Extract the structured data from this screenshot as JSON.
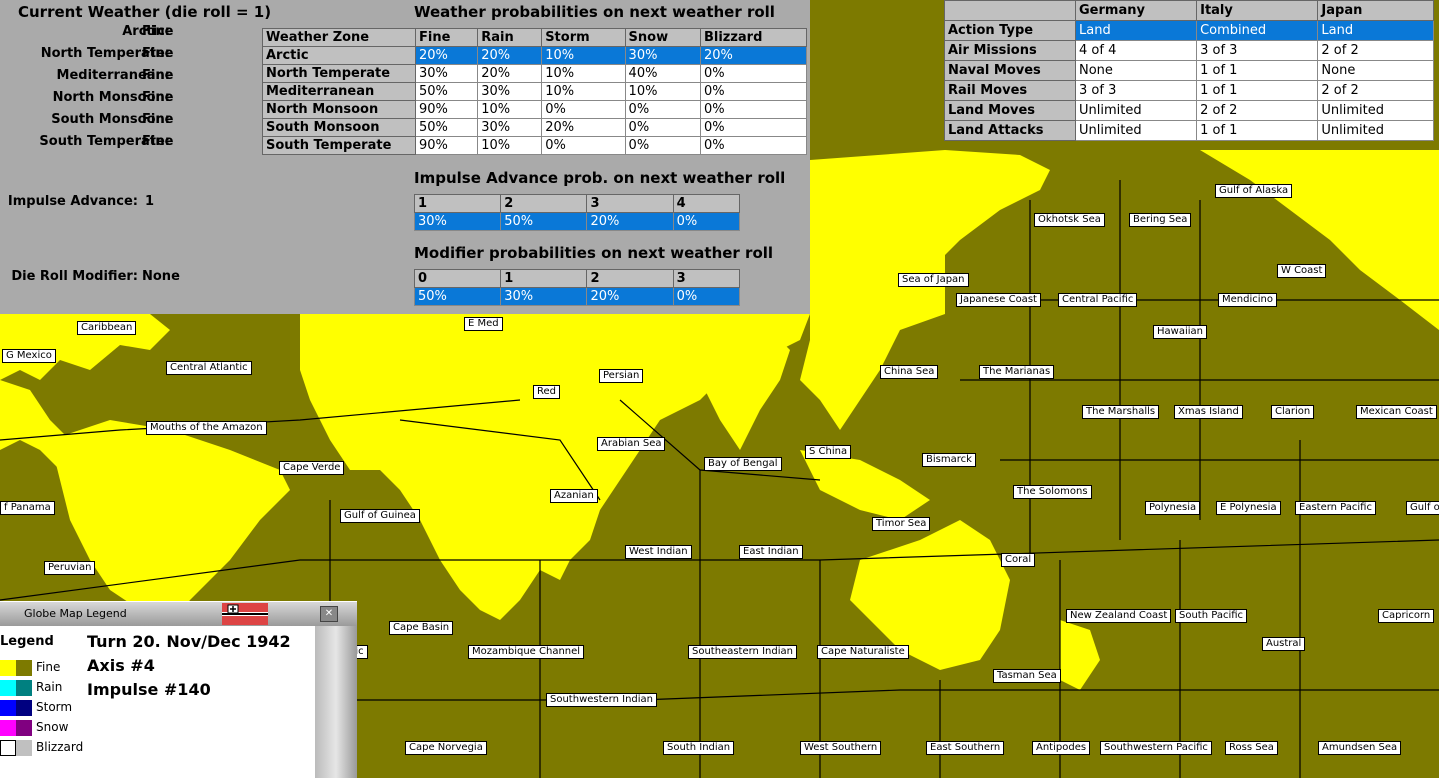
{
  "weather": {
    "title": "Current Weather (die roll = 1)",
    "zones": [
      {
        "label": "Arctic:",
        "value": "Fine"
      },
      {
        "label": "North Temperate:",
        "value": "Fine"
      },
      {
        "label": "Mediterranean:",
        "value": "Fine"
      },
      {
        "label": "North Monsoon:",
        "value": "Fine"
      },
      {
        "label": "South Monsoon:",
        "value": "Fine"
      },
      {
        "label": "South Temperate:",
        "value": "Fine"
      }
    ],
    "impulse_advance_label": "Impulse Advance:",
    "impulse_advance_value": "1",
    "die_roll_modifier_label": "Die Roll Modifier:",
    "die_roll_modifier_value": "None"
  },
  "probabilities": {
    "title": "Weather probabilities on next weather roll",
    "headers": [
      "Weather Zone",
      "Fine",
      "Rain",
      "Storm",
      "Snow",
      "Blizzard"
    ],
    "rows": [
      [
        "Arctic",
        "20%",
        "20%",
        "10%",
        "30%",
        "20%"
      ],
      [
        "North Temperate",
        "30%",
        "20%",
        "10%",
        "40%",
        "0%"
      ],
      [
        "Mediterranean",
        "50%",
        "30%",
        "10%",
        "10%",
        "0%"
      ],
      [
        "North Monsoon",
        "90%",
        "10%",
        "0%",
        "0%",
        "0%"
      ],
      [
        "South Monsoon",
        "50%",
        "30%",
        "20%",
        "0%",
        "0%"
      ],
      [
        "South Temperate",
        "90%",
        "10%",
        "0%",
        "0%",
        "0%"
      ]
    ]
  },
  "impulse_prob": {
    "title": "Impulse Advance prob. on next weather roll",
    "headers": [
      "1",
      "2",
      "3",
      "4"
    ],
    "values": [
      "30%",
      "50%",
      "20%",
      "0%"
    ]
  },
  "modifier_prob": {
    "title": "Modifier probabilities on next weather roll",
    "headers": [
      "0",
      "1",
      "2",
      "3"
    ],
    "values": [
      "50%",
      "30%",
      "20%",
      "0%"
    ]
  },
  "actions": {
    "headers": [
      "",
      "Germany",
      "Italy",
      "Japan"
    ],
    "rows": [
      [
        "Action Type",
        "Land",
        "Combined",
        "Land"
      ],
      [
        "Air Missions",
        "4 of 4",
        "3 of 3",
        "2 of 2"
      ],
      [
        "Naval Moves",
        "None",
        "1 of 1",
        "None"
      ],
      [
        "Rail Moves",
        "3 of 3",
        "1 of 1",
        "2 of 2"
      ],
      [
        "Land Moves",
        "Unlimited",
        "2 of 2",
        "Unlimited"
      ],
      [
        "Land Attacks",
        "Unlimited",
        "1 of 1",
        "Unlimited"
      ]
    ]
  },
  "legend": {
    "window_title": "Globe Map Legend",
    "heading": "Legend",
    "items": [
      {
        "label": "Fine",
        "color_a": "#ffff00",
        "color_b": "#7d7a00"
      },
      {
        "label": "Rain",
        "color_a": "#00ffff",
        "color_b": "#008080"
      },
      {
        "label": "Storm",
        "color_a": "#0000ff",
        "color_b": "#000080"
      },
      {
        "label": "Snow",
        "color_a": "#ff00ff",
        "color_b": "#800080"
      },
      {
        "label": "Blizzard",
        "color_a": "#ffffff",
        "color_b": "#c0c0c0"
      }
    ],
    "turn": "Turn 20.  Nov/Dec 1942",
    "side": "Axis #4",
    "impulse": "Impulse #140"
  },
  "sea_areas": [
    "Gulf of Alaska",
    "Okhotsk Sea",
    "Bering Sea",
    "W Coast",
    "Sea of Japan",
    "Japanese Coast",
    "Central Pacific",
    "Mendicino",
    "Hawaiian",
    "E Med",
    "Caribbean",
    "G Mexico",
    "Central Atlantic",
    "Red",
    "Persian",
    "China Sea",
    "The Marianas",
    "The Marshalls",
    "Xmas Island",
    "Clarion",
    "Mexican Coast",
    "Mouths of the Amazon",
    "Arabian Sea",
    "S China",
    "Bay of Bengal",
    "Bismarck",
    "Cape Verde",
    "Azanian",
    "The Solomons",
    "f Panama",
    "Gulf of Guinea",
    "Polynesia",
    "E Polynesia",
    "Eastern Pacific",
    "Gulf o",
    "Timor Sea",
    "West Indian",
    "East Indian",
    "Coral",
    "Peruvian",
    "New Zealand Coast",
    "South Pacific",
    "Capricorn",
    "Cape Basin",
    "Austral",
    "antic",
    "Mozambique Channel",
    "Southeastern Indian",
    "Cape Naturaliste",
    "Tasman Sea",
    "Southwestern Indian",
    "Cape Norvegia",
    "South Indian",
    "West Southern",
    "East Southern",
    "Antipodes",
    "Southwestern Pacific",
    "Ross Sea",
    "Amundsen Sea"
  ]
}
